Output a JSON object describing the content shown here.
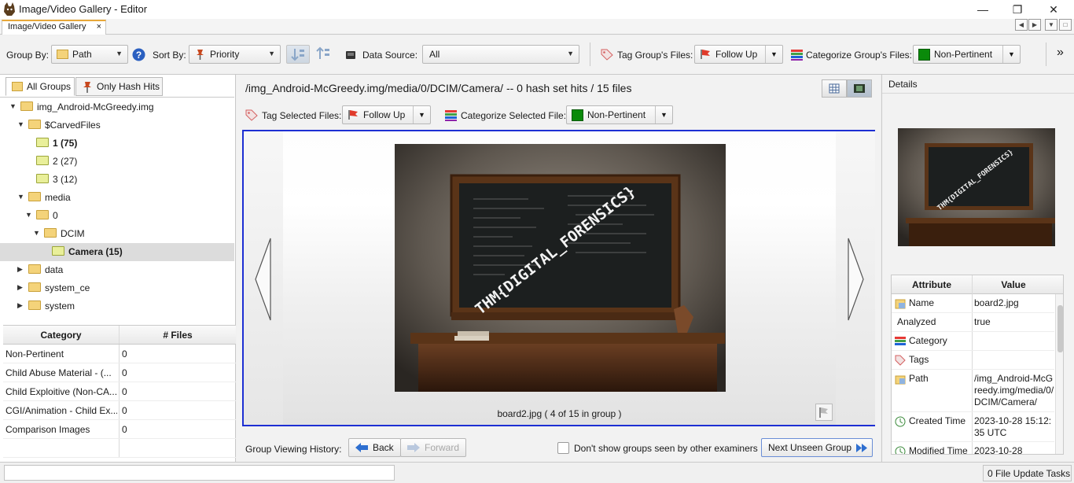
{
  "window": {
    "title": "Image/Video Gallery - Editor",
    "controls": {
      "minimize": "—",
      "restore": "❐",
      "close": "✕"
    }
  },
  "tab": {
    "label": "Image/Video Gallery",
    "close": "×"
  },
  "toolbar": {
    "group_by_label": "Group By:",
    "group_by_value": "Path",
    "sort_by_label": "Sort By:",
    "sort_by_value": "Priority",
    "data_source_label": "Data Source:",
    "data_source_value": "All",
    "tag_group_label": "Tag Group's Files:",
    "tag_group_value": "Follow Up",
    "categorize_group_label": "Categorize Group's Files:",
    "categorize_group_value": "Non-Pertinent",
    "overflow": "»"
  },
  "left": {
    "tabs": [
      "All Groups",
      "Only Hash Hits"
    ],
    "tree": [
      {
        "label": "img_Android-McGreedy.img",
        "indent": 0,
        "expanded": true,
        "bold": false,
        "type": "folder"
      },
      {
        "label": "$CarvedFiles",
        "indent": 1,
        "expanded": true,
        "bold": false,
        "type": "folder"
      },
      {
        "label": "1 (75)",
        "indent": 2,
        "expanded": null,
        "bold": true,
        "type": "group"
      },
      {
        "label": "2 (27)",
        "indent": 2,
        "expanded": null,
        "bold": false,
        "type": "group"
      },
      {
        "label": "3 (12)",
        "indent": 2,
        "expanded": null,
        "bold": false,
        "type": "group"
      },
      {
        "label": "media",
        "indent": 1,
        "expanded": true,
        "bold": false,
        "type": "folder"
      },
      {
        "label": "0",
        "indent": 2,
        "expanded": true,
        "bold": false,
        "type": "folder"
      },
      {
        "label": "DCIM",
        "indent": 3,
        "expanded": true,
        "bold": false,
        "type": "folder"
      },
      {
        "label": "Camera (15)",
        "indent": 4,
        "expanded": null,
        "bold": true,
        "type": "group",
        "selected": true
      },
      {
        "label": "data",
        "indent": 1,
        "expanded": false,
        "bold": false,
        "type": "folder"
      },
      {
        "label": "system_ce",
        "indent": 1,
        "expanded": false,
        "bold": false,
        "type": "folder"
      },
      {
        "label": "system",
        "indent": 1,
        "expanded": false,
        "bold": false,
        "type": "folder"
      }
    ],
    "category_table": {
      "headers": [
        "Category",
        "# Files"
      ],
      "rows": [
        [
          "Non-Pertinent",
          "0"
        ],
        [
          "Child Abuse Material - (...",
          "0"
        ],
        [
          "Child Exploitive (Non-CA...",
          "0"
        ],
        [
          "CGI/Animation - Child Ex...",
          "0"
        ],
        [
          "Comparison Images",
          "0"
        ]
      ]
    }
  },
  "center": {
    "group_header": "/img_Android-McGreedy.img/media/0/DCIM/Camera/ -- 0 hash set hits / 15 files",
    "tag_selected_label": "Tag Selected Files:",
    "tag_selected_value": "Follow Up",
    "categorize_selected_label": "Categorize Selected File:",
    "categorize_selected_value": "Non-Pertinent",
    "image_overlay_text": "THM{DIGITAL_FORENSICS}",
    "caption": "board2.jpg   ( 4 of 15 in group )",
    "history_label": "Group Viewing History:",
    "back": "Back",
    "forward": "Forward",
    "dont_show_label": "Don't show groups seen by other examiners",
    "next_unseen": "Next Unseen Group"
  },
  "details": {
    "title": "Details",
    "headers": [
      "Attribute",
      "Value"
    ],
    "rows": [
      {
        "key": "Name",
        "value": "board2.jpg",
        "icon": "name-icon"
      },
      {
        "key": "Analyzed",
        "value": "true",
        "icon": ""
      },
      {
        "key": "Category",
        "value": "",
        "icon": "category-icon"
      },
      {
        "key": "Tags",
        "value": "",
        "icon": "tag-icon"
      },
      {
        "key": "Path",
        "value": "/img_Android-McGreedy.img/media/0/DCIM/Camera/",
        "icon": "path-icon"
      },
      {
        "key": "Created Time",
        "value": "2023-10-28 15:12:35 UTC",
        "icon": "clock-icon"
      },
      {
        "key": "Modified Time",
        "value": "2023-10-28",
        "icon": "clock-icon"
      }
    ]
  },
  "status": {
    "tasks": "0 File Update Tasks"
  },
  "colors": {
    "accent_border": "#1d2fd3",
    "non_pertinent": "#0a8a0a",
    "tab_accent": "#e8a83a"
  }
}
